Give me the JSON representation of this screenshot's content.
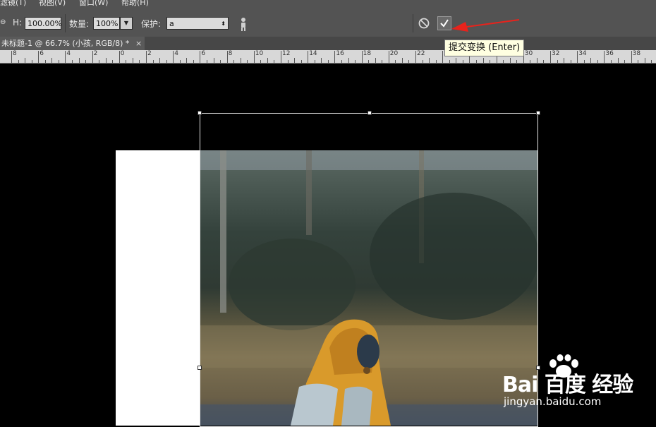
{
  "menubar": {
    "items": [
      "滤镜(T)",
      "视图(V)",
      "窗口(W)",
      "帮助(H)"
    ]
  },
  "options_bar": {
    "h_label": "H:",
    "h_value": "100.00%",
    "quantity_label": "数量:",
    "quantity_value": "100%",
    "protect_label": "保护:",
    "protect_value": "a"
  },
  "tooltip": {
    "text": "提交变换 (Enter)"
  },
  "document_tab": {
    "title": "未标题-1 @ 66.7% (小孩, RGB/8) *",
    "close": "×"
  },
  "ruler": {
    "labels": [
      "8",
      "6",
      "4",
      "2",
      "0",
      "2",
      "4",
      "6",
      "8",
      "10",
      "12",
      "14",
      "16",
      "18",
      "20",
      "22",
      "24",
      "26",
      "28",
      "30",
      "32",
      "34",
      "36",
      "38"
    ]
  },
  "watermark": {
    "logo": "Bai 百度 经验",
    "url": "jingyan.baidu.com"
  },
  "colors": {
    "ui_panel": "#535353",
    "arrow": "#e8231c",
    "tooltip_bg": "#ffffe1"
  },
  "icons": {
    "link": "link-icon",
    "content_aware": "person-icon",
    "cancel": "cancel-transform-icon",
    "commit": "commit-checkmark-icon"
  }
}
